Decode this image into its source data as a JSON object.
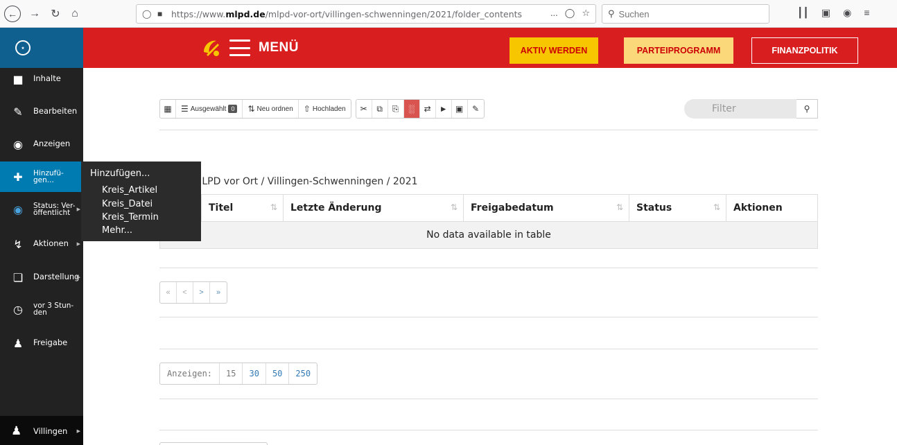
{
  "browser": {
    "url_prefix": "https://www.",
    "url_domain": "mlpd.de",
    "url_path": "/mlpd-vor-ort/villingen-schwenningen/2021/folder_contents",
    "search_placeholder": "Suchen",
    "more_icon": "...",
    "icons": [
      "back-icon",
      "forward-icon",
      "reload-icon",
      "home-icon",
      "shield-icon",
      "lock-icon",
      "pocket-icon",
      "bookmark-star-icon",
      "search-icon",
      "library-icon",
      "sidebar-icon",
      "account-icon",
      "menu-icon"
    ]
  },
  "header": {
    "menu_label": "MENÜ",
    "buttons": {
      "aktiv": "AKTIV WERDEN",
      "programm": "PARTEIPROGRAMM",
      "finanz": "FINANZPOLITIK"
    },
    "colors": {
      "bar": "#d81e1e",
      "aktiv_bg": "#f7c600",
      "programm_bg": "#fbd97a"
    }
  },
  "sidebar": {
    "items": [
      {
        "label": "Inhalte",
        "icon": "folder-icon"
      },
      {
        "label": "Bearbeiten",
        "icon": "pencil-icon"
      },
      {
        "label": "Anzeigen",
        "icon": "eye-icon"
      },
      {
        "label_1": "Hinzufü-",
        "label_2": "gen...",
        "icon": "plus-icon"
      },
      {
        "label_1": "Status: Ver-",
        "label_2": "öffentlicht",
        "icon": "globe-icon"
      },
      {
        "label": "Aktionen",
        "icon": "bolt-icon"
      },
      {
        "label": "Darstellung",
        "icon": "display-icon"
      },
      {
        "label_1": "vor 3 Stun-",
        "label_2": "den",
        "icon": "clock-icon"
      },
      {
        "label": "Freigabe",
        "icon": "users-icon"
      }
    ],
    "user": {
      "label": "Villingen",
      "icon": "user-icon"
    }
  },
  "add_menu": {
    "title": "Hinzufügen...",
    "options": [
      "Kreis_Artikel",
      "Kreis_Datei",
      "Kreis_Termin",
      "Mehr..."
    ]
  },
  "toolbar": {
    "selected_label": "Ausgewählt",
    "selected_count": "0",
    "reorder_label": "Neu ordnen",
    "upload_label": "Hochladen",
    "icon_buttons": [
      "cut-icon",
      "copy-icon",
      "paste-icon",
      "delete-icon",
      "rename-icon",
      "tags-icon",
      "lock-icon",
      "properties-icon"
    ]
  },
  "filter": {
    "placeholder": "Filter"
  },
  "breadcrumb": "2021 / MLPD vor Ort / Villingen-Schwenningen / 2021",
  "table": {
    "columns": [
      "Titel",
      "Letzte Änderung",
      "Freigabedatum",
      "Status",
      "Aktionen"
    ],
    "empty_message": "No data available in table"
  },
  "pagination": [
    "«",
    "<",
    ">",
    "»"
  ],
  "show": {
    "label": "Anzeigen:",
    "options": [
      "15",
      "30",
      "50",
      "250"
    ]
  }
}
